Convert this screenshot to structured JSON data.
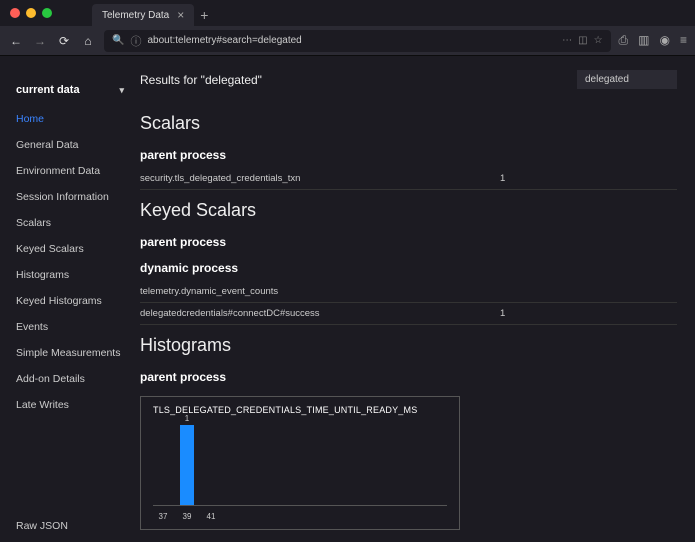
{
  "window": {
    "tab_title": "Telemetry Data",
    "url": "about:telemetry#search=delegated"
  },
  "sidebar": {
    "title": "current data",
    "items": [
      {
        "label": "Home",
        "active": true
      },
      {
        "label": "General Data"
      },
      {
        "label": "Environment Data"
      },
      {
        "label": "Session Information"
      },
      {
        "label": "Scalars"
      },
      {
        "label": "Keyed Scalars"
      },
      {
        "label": "Histograms"
      },
      {
        "label": "Keyed Histograms"
      },
      {
        "label": "Events"
      },
      {
        "label": "Simple Measurements"
      },
      {
        "label": "Add-on Details"
      },
      {
        "label": "Late Writes"
      }
    ],
    "footer": "Raw JSON"
  },
  "main": {
    "results_text": "Results for \"delegated\"",
    "search_value": "delegated",
    "sections": {
      "scalars": {
        "heading": "Scalars",
        "groups": [
          {
            "title": "parent process",
            "rows": [
              {
                "k": "security.tls_delegated_credentials_txn",
                "v": "1"
              }
            ]
          }
        ]
      },
      "keyed_scalars": {
        "heading": "Keyed Scalars",
        "groups": [
          {
            "title": "parent process",
            "rows": []
          },
          {
            "title": "dynamic process",
            "rows": [
              {
                "k": "telemetry.dynamic_event_counts",
                "v": ""
              },
              {
                "k": "delegatedcredentials#connectDC#success",
                "v": "1"
              }
            ]
          }
        ]
      },
      "histograms": {
        "heading": "Histograms",
        "groups": [
          {
            "title": "parent process"
          }
        ]
      }
    }
  },
  "chart_data": {
    "type": "bar",
    "title": "TLS_DELEGATED_CREDENTIALS_TIME_UNTIL_READY_MS",
    "categories": [
      "37",
      "39",
      "41"
    ],
    "values": [
      0,
      1,
      0
    ],
    "ylim": [
      0,
      1
    ]
  }
}
